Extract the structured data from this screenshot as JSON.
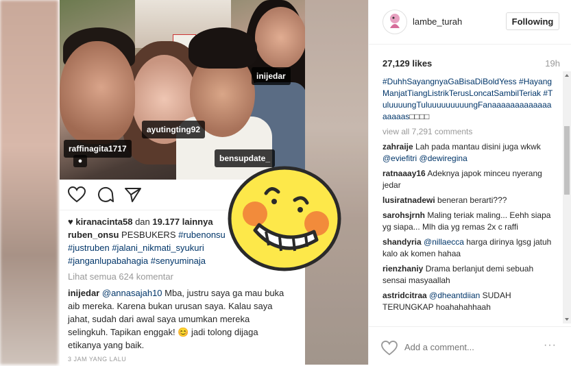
{
  "photo_tags": {
    "tag1": "inijedar",
    "tag2": "ayutingting92",
    "tag3": "raffinagita1717",
    "tag4": "bensupdate_"
  },
  "post": {
    "liked_by_user": "kiranacinta58",
    "liked_by_mid": " dan ",
    "liked_by_count": "19.177 lainnya",
    "caption_user": "ruben_onsu",
    "caption_text": " PESBUKERS ",
    "caption_mention": "#rubenonsu",
    "caption_tags1": "#justruben #jalani_nikmati_syukuri",
    "caption_tags2": "#janganlupabahagia #senyuminaja",
    "view_comments": "Lihat semua 624 komentar",
    "reply_user": "inijedar",
    "reply_mention": "@annasajah10",
    "reply_line1": " Mba, justru saya ga mau buka",
    "reply_line2": "aib mereka. Karena bukan urusan saya. Kalau saya",
    "reply_line3": "jahat, sudah dari awal saya umumkan mereka",
    "reply_line4a": "selingkuh. Tapikan enggak! ",
    "reply_emoji": "😊",
    "reply_line4b": " jadi tolong dijaga",
    "reply_line5": "etikanya yang baik.",
    "timestamp": "3 JAM YANG LALU"
  },
  "panel": {
    "username": "lambe_turah",
    "follow_label": "Following",
    "likes": "27,129 likes",
    "time_ago": "19h",
    "hashtags": "#DuhhSayangnyaGaBisaDiBoldYess #HayangManjatTiangListrikTerusLoncatSambilTeriak #TuluuuungTuluuuuuuuuungFanaaaaaaaaaaaaaaaaaas",
    "hashtag_tail": "□□□□",
    "view_all": "view all 7,291 comments",
    "comments": [
      {
        "user": "zahraije",
        "text": "Lah pada mantau disini juga wkwk ",
        "mentions": "@eviefitri @dewiregina",
        "after": ""
      },
      {
        "user": "ratnaaay16",
        "text": "Adeknya japok minceu nyerang jedar",
        "mentions": "",
        "after": ""
      },
      {
        "user": "lusiratnadewi",
        "text": "beneran berarti???",
        "mentions": "",
        "after": ""
      },
      {
        "user": "sarohsjrnh",
        "text": "Maling teriak maling... Eehh siapa yg siapa... Mlh dia yg remas 2x c raffi",
        "mentions": "",
        "after": ""
      },
      {
        "user": "shandyria",
        "text": "",
        "mentions": "@nillaecca",
        "after": " harga dirinya lgsg jatuh kalo ak komen hahaa"
      },
      {
        "user": "rienzhaniy",
        "text": "Drama berlanjut demi sebuah sensai masyaallah",
        "mentions": "",
        "after": ""
      },
      {
        "user": "astridcitraa",
        "text": "",
        "mentions": "@dheantdiian",
        "after": " SUDAH TERUNGKAP hoahahahhaah"
      }
    ],
    "add_comment_placeholder": "Add a comment...",
    "more_label": "···"
  },
  "icons": {
    "heart": "heart-icon",
    "comment": "comment-icon",
    "share": "share-icon",
    "user_tag": "user-tag-icon",
    "more": "more-options-icon"
  }
}
